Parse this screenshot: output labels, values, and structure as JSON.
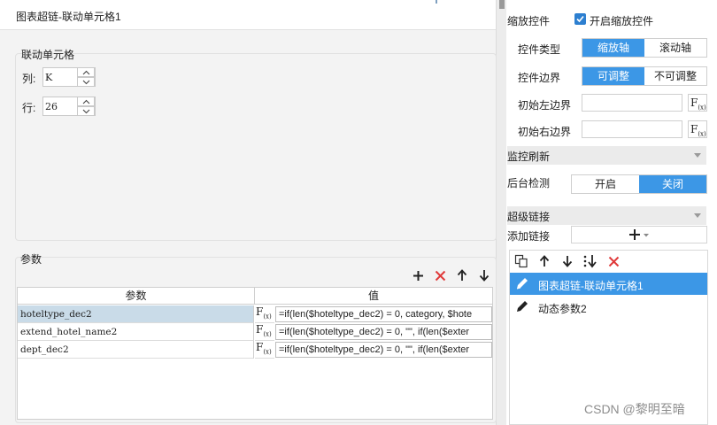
{
  "dialog": {
    "title": "图表超链-联动单元格1",
    "cell_group": {
      "title": "联动单元格",
      "column_label": "列:",
      "column_value": "K",
      "row_label": "行:",
      "row_value": "26"
    },
    "param_group": {
      "title": "参数",
      "toolbar": [
        "plus-icon",
        "delete-icon",
        "arrow-up-icon",
        "arrow-down-icon"
      ],
      "table": {
        "headers": [
          "参数",
          "值"
        ],
        "rows": [
          {
            "name": "hoteltype_dec2",
            "fx": "F(x)",
            "value": "=if(len($hoteltype_dec2) = 0, category, $hote"
          },
          {
            "name": "extend_hotel_name2",
            "fx": "F(x)",
            "value": "=if(len($hoteltype_dec2) = 0, \"\", if(len($exter"
          },
          {
            "name": "dept_dec2",
            "fx": "F(x)",
            "value": "=if(len($hoteltype_dec2) = 0, \"\", if(len($exter"
          }
        ]
      }
    }
  },
  "right_panel": {
    "zoom_control_label": "缩放控件",
    "enable_zoom_label": "开启缩放控件",
    "enable_zoom_checked": true,
    "control_type_label": "控件类型",
    "control_type_options": [
      "缩放轴",
      "滚动轴"
    ],
    "control_type_selected": "缩放轴",
    "control_boundary_label": "控件边界",
    "control_boundary_options": [
      "可调整",
      "不可调整"
    ],
    "control_boundary_selected": "可调整",
    "init_left_label": "初始左边界",
    "init_left_value": "",
    "init_right_label": "初始右边界",
    "init_right_value": "",
    "fx_label": "F(x)",
    "monitor_refresh_label": "监控刷新",
    "background_check_label": "后台检测",
    "background_check_options": [
      "开启",
      "关闭"
    ],
    "background_check_selected": "关闭",
    "hyperlink_label": "超级链接",
    "add_link_label": "添加链接",
    "link_toolbar": [
      "copy-icon",
      "arrow-up-icon",
      "arrow-down-icon",
      "move-icon",
      "delete-icon"
    ],
    "links": [
      {
        "label": "图表超链-联动单元格1",
        "selected": true
      },
      {
        "label": "动态参数2",
        "selected": false
      }
    ]
  },
  "watermark": "CSDN @黎明至暗",
  "colors": {
    "accent": "#3c97e6",
    "delete": "#e03a3a",
    "selected_row": "#c9dbe8"
  }
}
